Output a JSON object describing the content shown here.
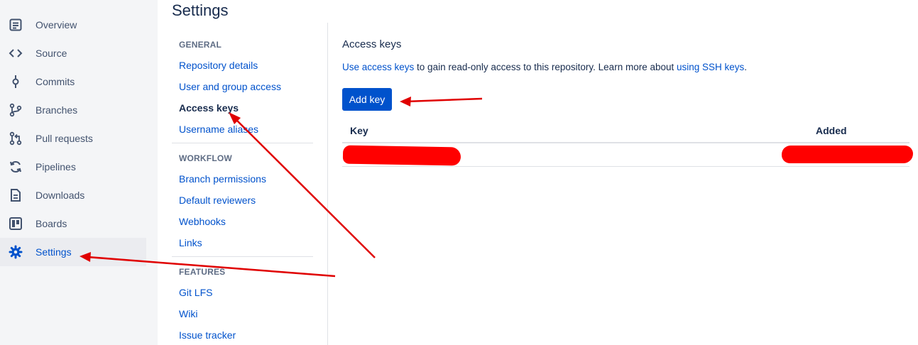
{
  "page": {
    "title": "Settings"
  },
  "sidebar": {
    "items": [
      {
        "label": "Overview",
        "icon": "overview-icon"
      },
      {
        "label": "Source",
        "icon": "source-code-icon"
      },
      {
        "label": "Commits",
        "icon": "commit-icon"
      },
      {
        "label": "Branches",
        "icon": "branch-icon"
      },
      {
        "label": "Pull requests",
        "icon": "pull-request-icon"
      },
      {
        "label": "Pipelines",
        "icon": "pipelines-icon"
      },
      {
        "label": "Downloads",
        "icon": "downloads-icon"
      },
      {
        "label": "Boards",
        "icon": "boards-icon"
      },
      {
        "label": "Settings",
        "icon": "gear-icon"
      }
    ],
    "active": "Settings"
  },
  "settings_nav": {
    "general_heading": "GENERAL",
    "general": [
      "Repository details",
      "User and group access",
      "Access keys",
      "Username aliases"
    ],
    "workflow_heading": "WORKFLOW",
    "workflow": [
      "Branch permissions",
      "Default reviewers",
      "Webhooks",
      "Links"
    ],
    "features_heading": "FEATURES",
    "features": [
      "Git LFS",
      "Wiki",
      "Issue tracker"
    ],
    "current": "Access keys"
  },
  "content": {
    "title": "Access keys",
    "desc_link1": "Use access keys",
    "desc_mid": " to gain read-only access to this repository. Learn more about ",
    "desc_link2": "using SSH keys",
    "desc_end": ".",
    "add_button": "Add key",
    "table": {
      "headers": [
        "Key",
        "Added"
      ]
    }
  },
  "colors": {
    "accent": "#0052cc",
    "sidebar_bg": "#f4f5f7",
    "annotation": "#e00000",
    "redaction": "#ff0000"
  }
}
